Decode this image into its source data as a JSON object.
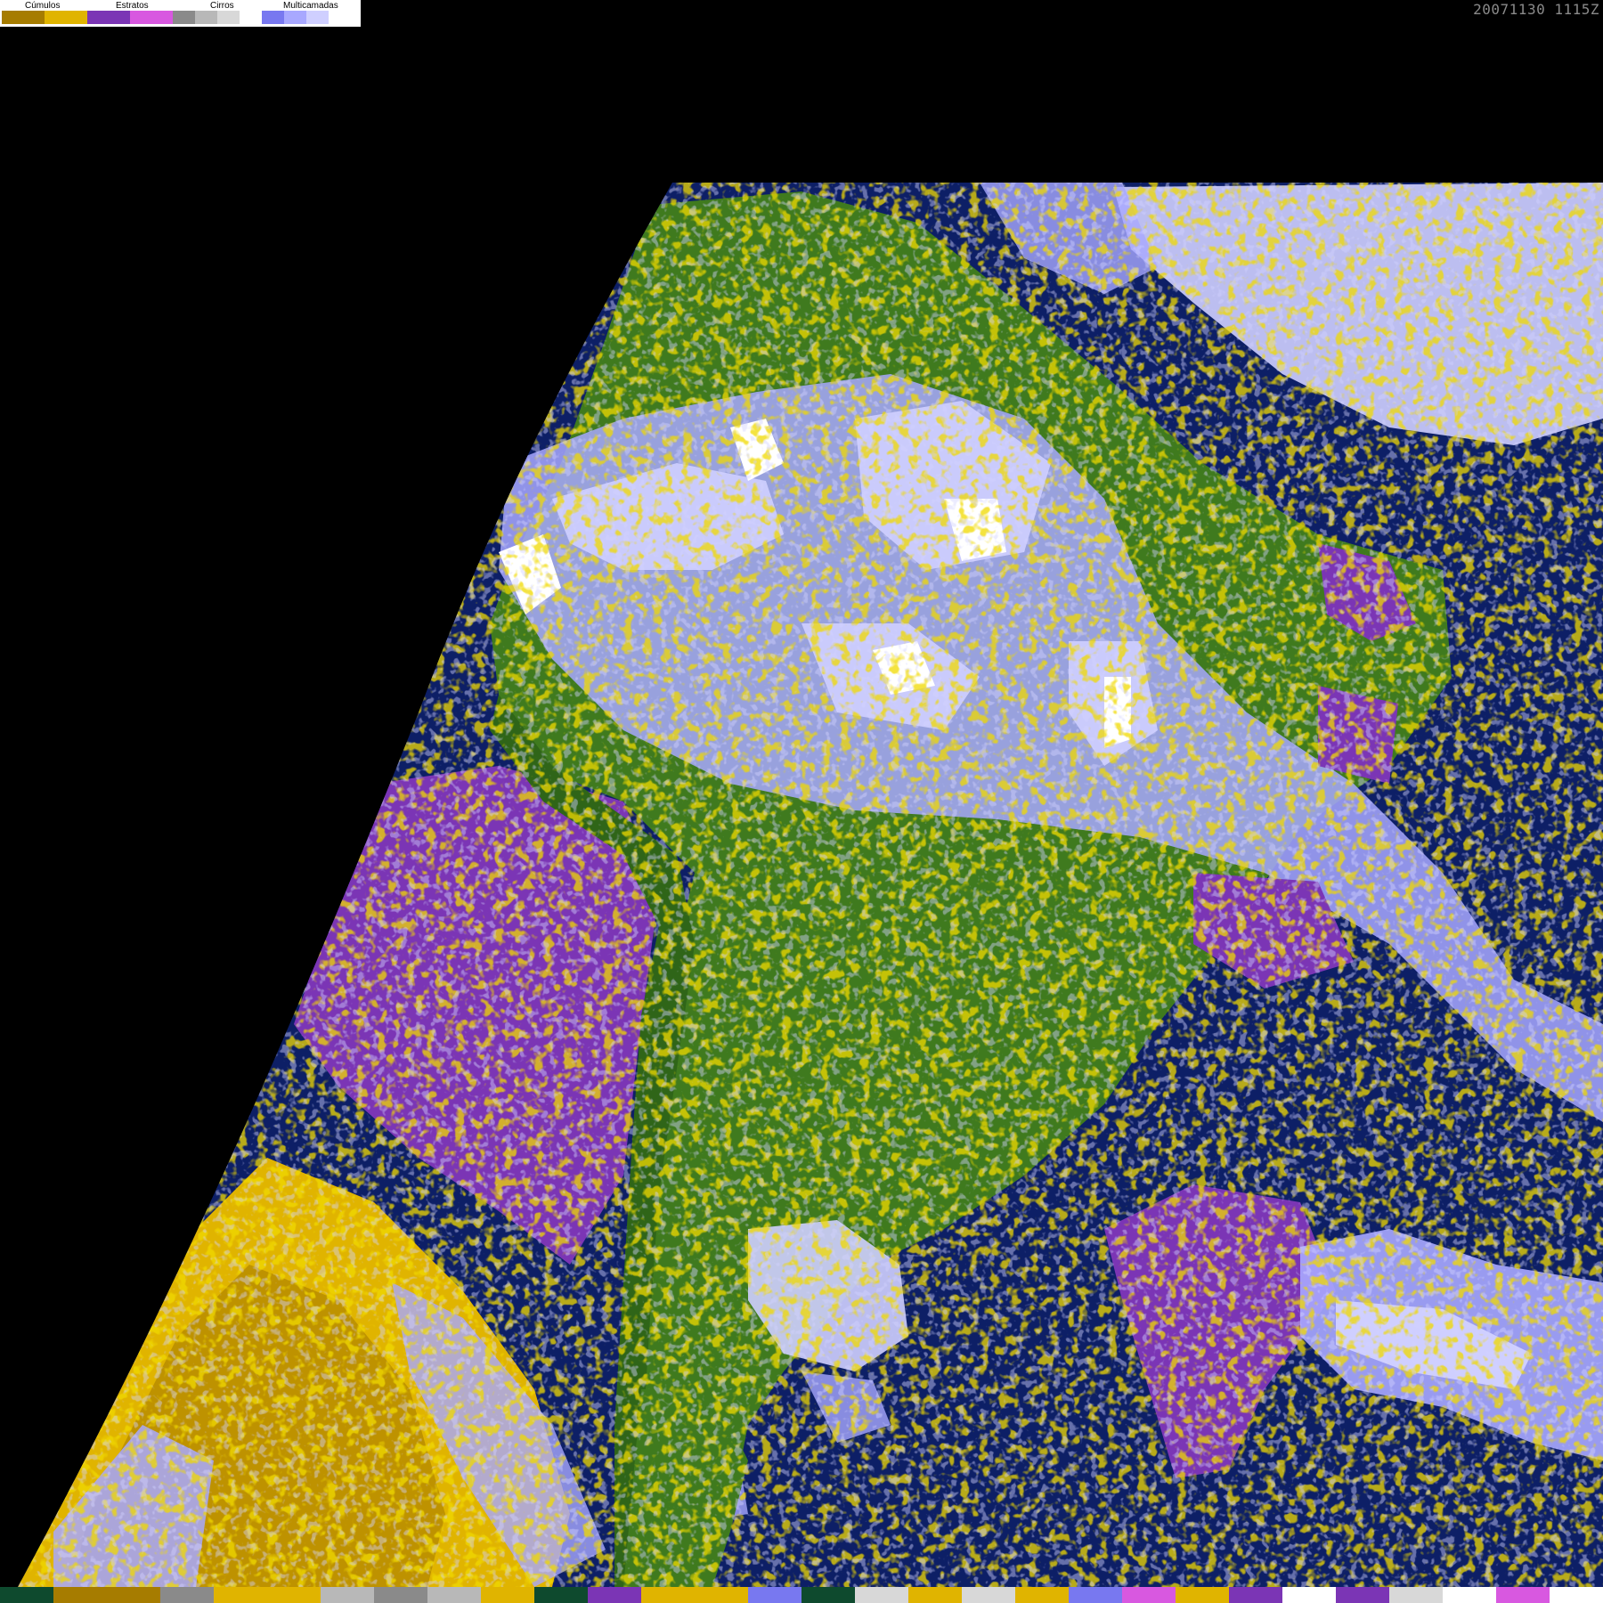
{
  "legend": {
    "labels": [
      "Cúmulos",
      "Estratos",
      "Cirros",
      "Multicamadas"
    ],
    "groups": [
      [
        "#a67c00",
        "#e0b400"
      ],
      [
        "#7b35b5",
        "#d858e0"
      ],
      [
        "#8a8a8a",
        "#b8b8b8",
        "#d8d8d8",
        "#ffffff"
      ],
      [
        "#7878f0",
        "#a8a8ff",
        "#cfcfff",
        "#ffffff"
      ]
    ]
  },
  "timestamp": "20071130 1115Z",
  "colors": {
    "space": "#000000",
    "ocean": "#0d1f66",
    "land": "#3f7a1e",
    "land_dark": "#2f6518",
    "stratus": "#7b35b5",
    "stratus_light": "#d858e0",
    "cumulus": "#a67c00",
    "cumulus_light": "#e0b400",
    "cirrus": "#b8b8b8",
    "multilayer": "#a8a8ff",
    "multilayer_light": "#cfcfff",
    "white": "#ffffff"
  },
  "bottom_strip": [
    "#0e4a2e",
    "#a67c00",
    "#a67c00",
    "#8a8a8a",
    "#e0b400",
    "#e0b400",
    "#b8b8b8",
    "#8a8a8a",
    "#b8b8b8",
    "#e0b400",
    "#0e4a2e",
    "#7b35b5",
    "#e0b400",
    "#e0b400",
    "#7878f0",
    "#0e4a2e",
    "#d8d8d8",
    "#e0b400",
    "#d8d8d8",
    "#e0b400",
    "#7878f0",
    "#d858e0",
    "#e0b400",
    "#7b35b5",
    "#ffffff",
    "#7b35b5",
    "#d8d8d8",
    "#ffffff",
    "#d858e0",
    "#ffffff"
  ]
}
